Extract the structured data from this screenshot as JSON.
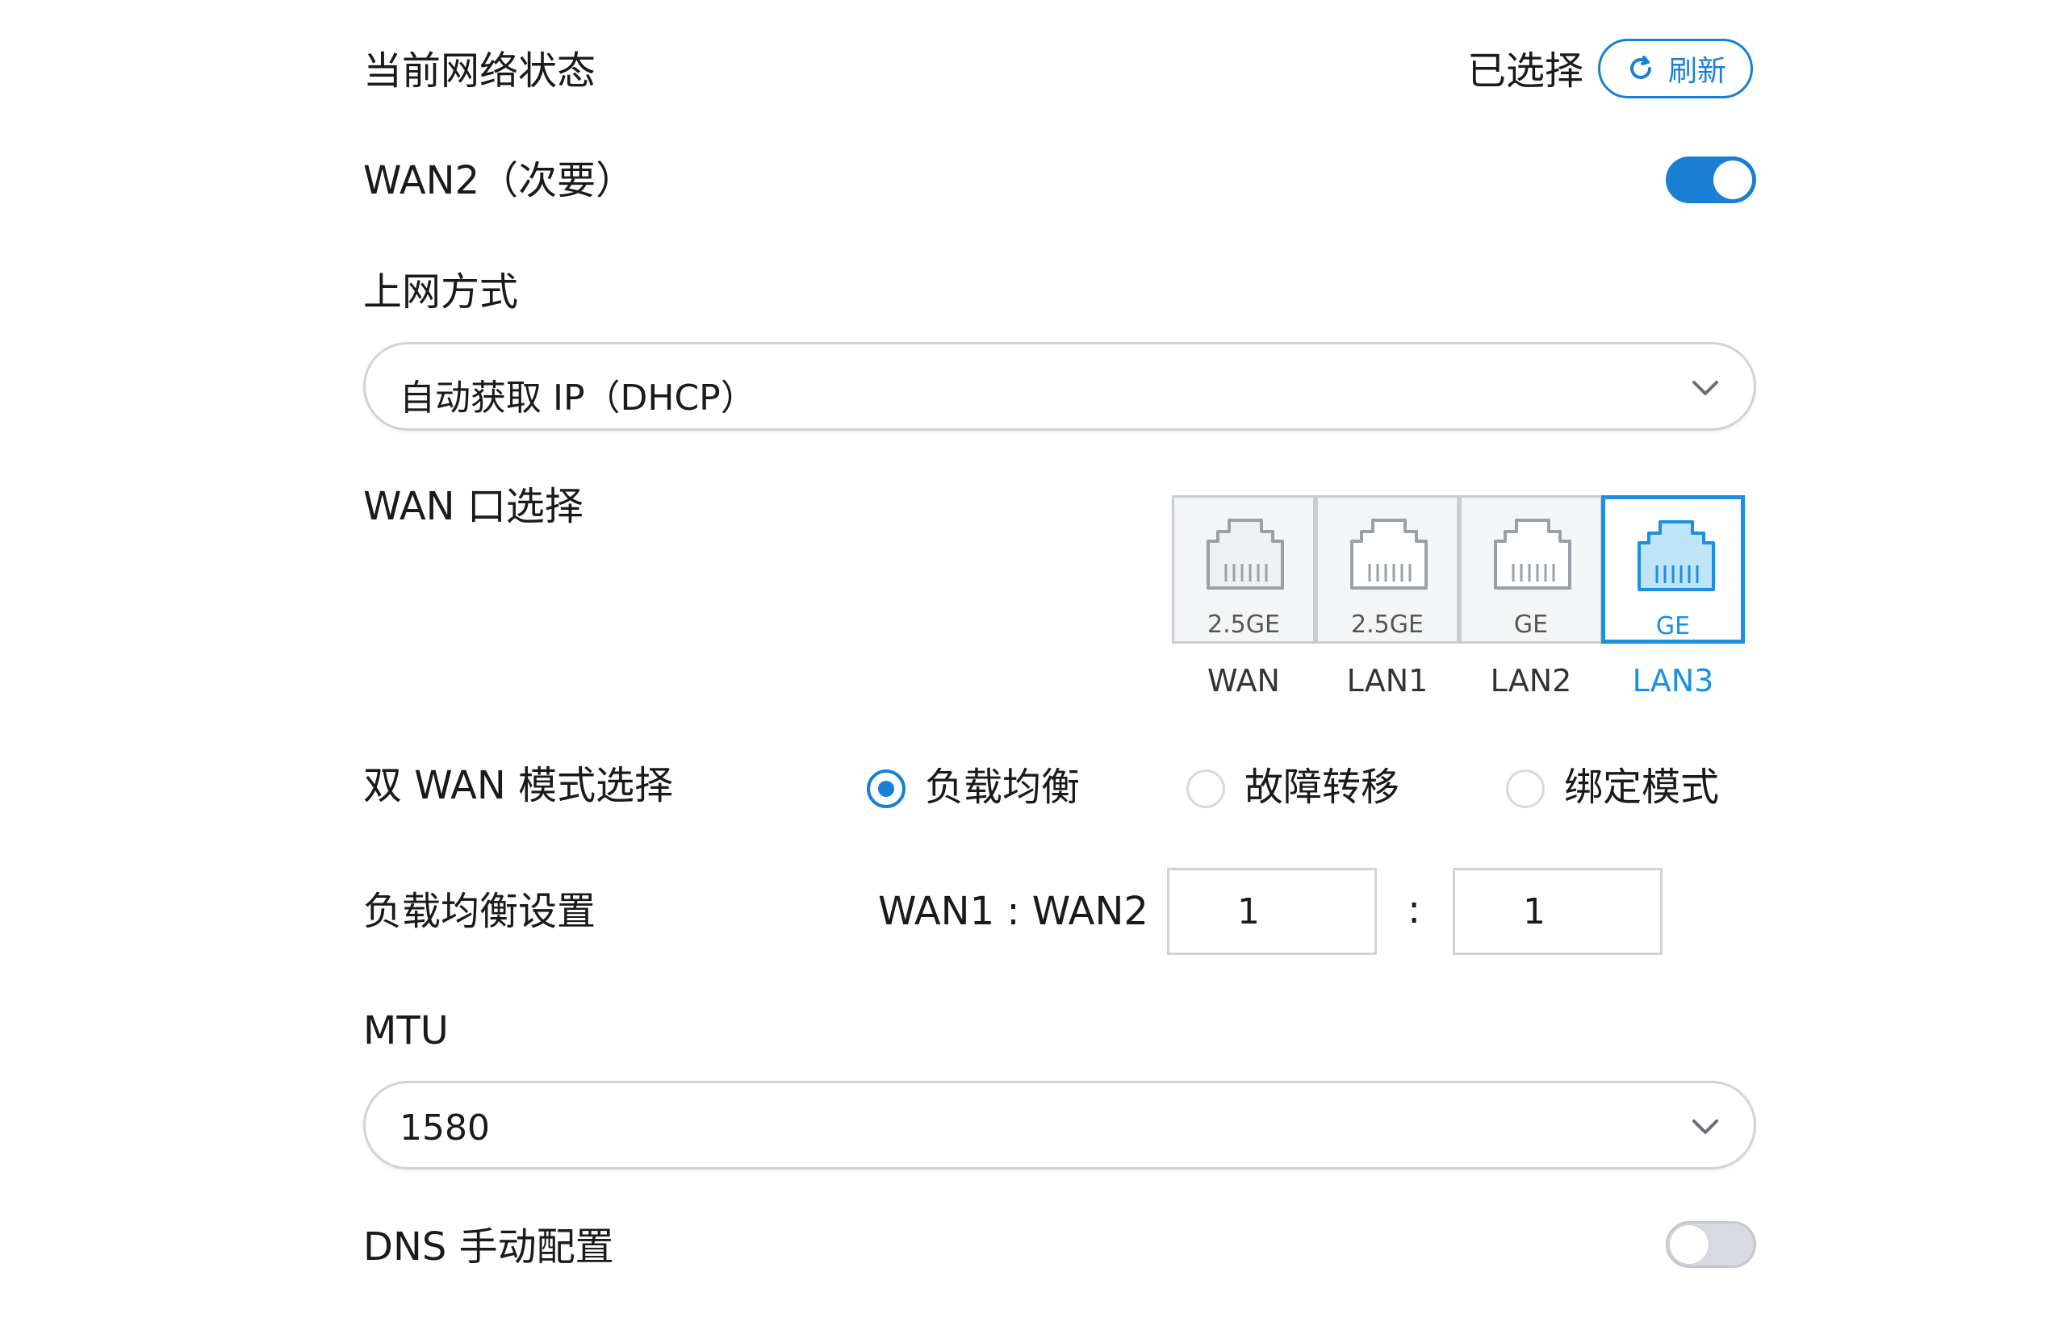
{
  "status": {
    "title": "当前网络状态",
    "state": "已选择",
    "refresh_label": "刷新"
  },
  "wan2": {
    "label": "WAN2（次要）",
    "enabled": true
  },
  "access_mode": {
    "label": "上网方式",
    "value": "自动获取 IP（DHCP）"
  },
  "wan_port": {
    "label": "WAN 口选择",
    "ports": [
      {
        "speed": "2.5GE",
        "name": "WAN",
        "selected": false
      },
      {
        "speed": "2.5GE",
        "name": "LAN1",
        "selected": false
      },
      {
        "speed": "GE",
        "name": "LAN2",
        "selected": false
      },
      {
        "speed": "GE",
        "name": "LAN3",
        "selected": true
      }
    ]
  },
  "dual_wan": {
    "label": "双 WAN 模式选择",
    "options": [
      {
        "label": "负载均衡",
        "selected": true
      },
      {
        "label": "故障转移",
        "selected": false
      },
      {
        "label": "绑定模式",
        "selected": false
      }
    ]
  },
  "load_balance": {
    "label": "负载均衡设置",
    "ratio_label": "WAN1 : WAN2",
    "separator": ":",
    "wan1_value": "1",
    "wan2_value": "1"
  },
  "mtu": {
    "label": "MTU",
    "value": "1580"
  },
  "dns": {
    "label": "DNS 手动配置",
    "enabled": false
  },
  "colors": {
    "accent": "#1a7fd4",
    "port_selected": "#1a8fe3",
    "border": "#d0d3d8"
  }
}
